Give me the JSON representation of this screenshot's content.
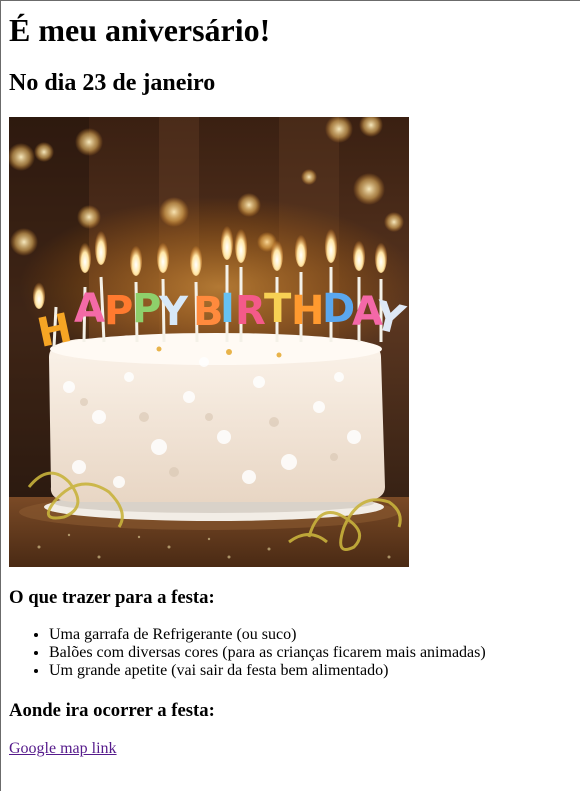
{
  "page": {
    "title": "É meu aniversário!",
    "subtitle": "No dia 23 de janeiro",
    "image": {
      "alt": "birthday-cake-photo",
      "candle_text": "HAPPY BIRTHDAY"
    },
    "bring_heading": "O que trazer para a festa:",
    "bring_items": [
      "Uma garrafa de Refrigerante (ou suco)",
      "Balões com diversas cores (para as crianças ficarem mais animadas)",
      "Um grande apetite (vai sair da festa bem alimentado)"
    ],
    "location_heading": "Aonde ira ocorrer a festa:",
    "map_link": "Google map link"
  },
  "colors": {
    "link_visited": "#551a8b",
    "background": "#ffffff"
  }
}
